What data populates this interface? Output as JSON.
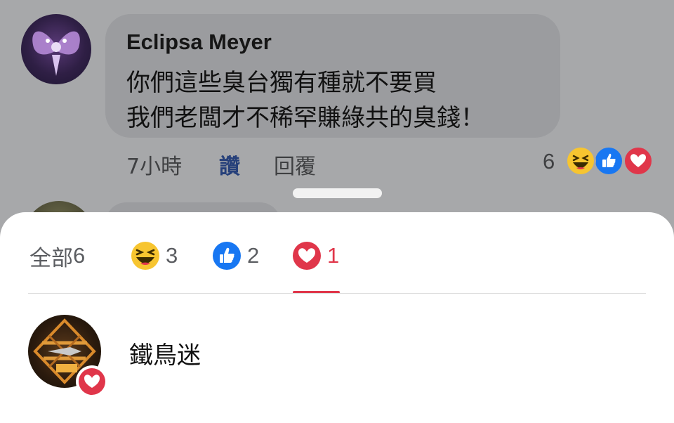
{
  "comment": {
    "author": "Eclipsa Meyer",
    "lines": [
      "你們這些臭台獨有種就不要買",
      "我們老闆才不稀罕賺綠共的臭錢！"
    ],
    "time": "7小時",
    "like_label": "讚",
    "reply_label": "回覆",
    "reaction_total": "6",
    "reaction_icons": [
      "haha-icon",
      "like-icon",
      "love-icon"
    ]
  },
  "reactions_sheet": {
    "tabs": [
      {
        "label": "全部",
        "count": "6",
        "icon": "",
        "active": false
      },
      {
        "label": "",
        "count": "3",
        "icon": "haha-icon",
        "active": false
      },
      {
        "label": "",
        "count": "2",
        "icon": "like-icon",
        "active": false
      },
      {
        "label": "",
        "count": "1",
        "icon": "love-icon",
        "active": true
      }
    ],
    "reactors": [
      {
        "name": "鐵鳥迷",
        "reaction": "love-icon"
      }
    ]
  },
  "colors": {
    "like_blue": "#1877f2",
    "love_red": "#e0364a",
    "haha_yellow": "#f7c530",
    "dim_overlay": "#a7a8aa"
  }
}
